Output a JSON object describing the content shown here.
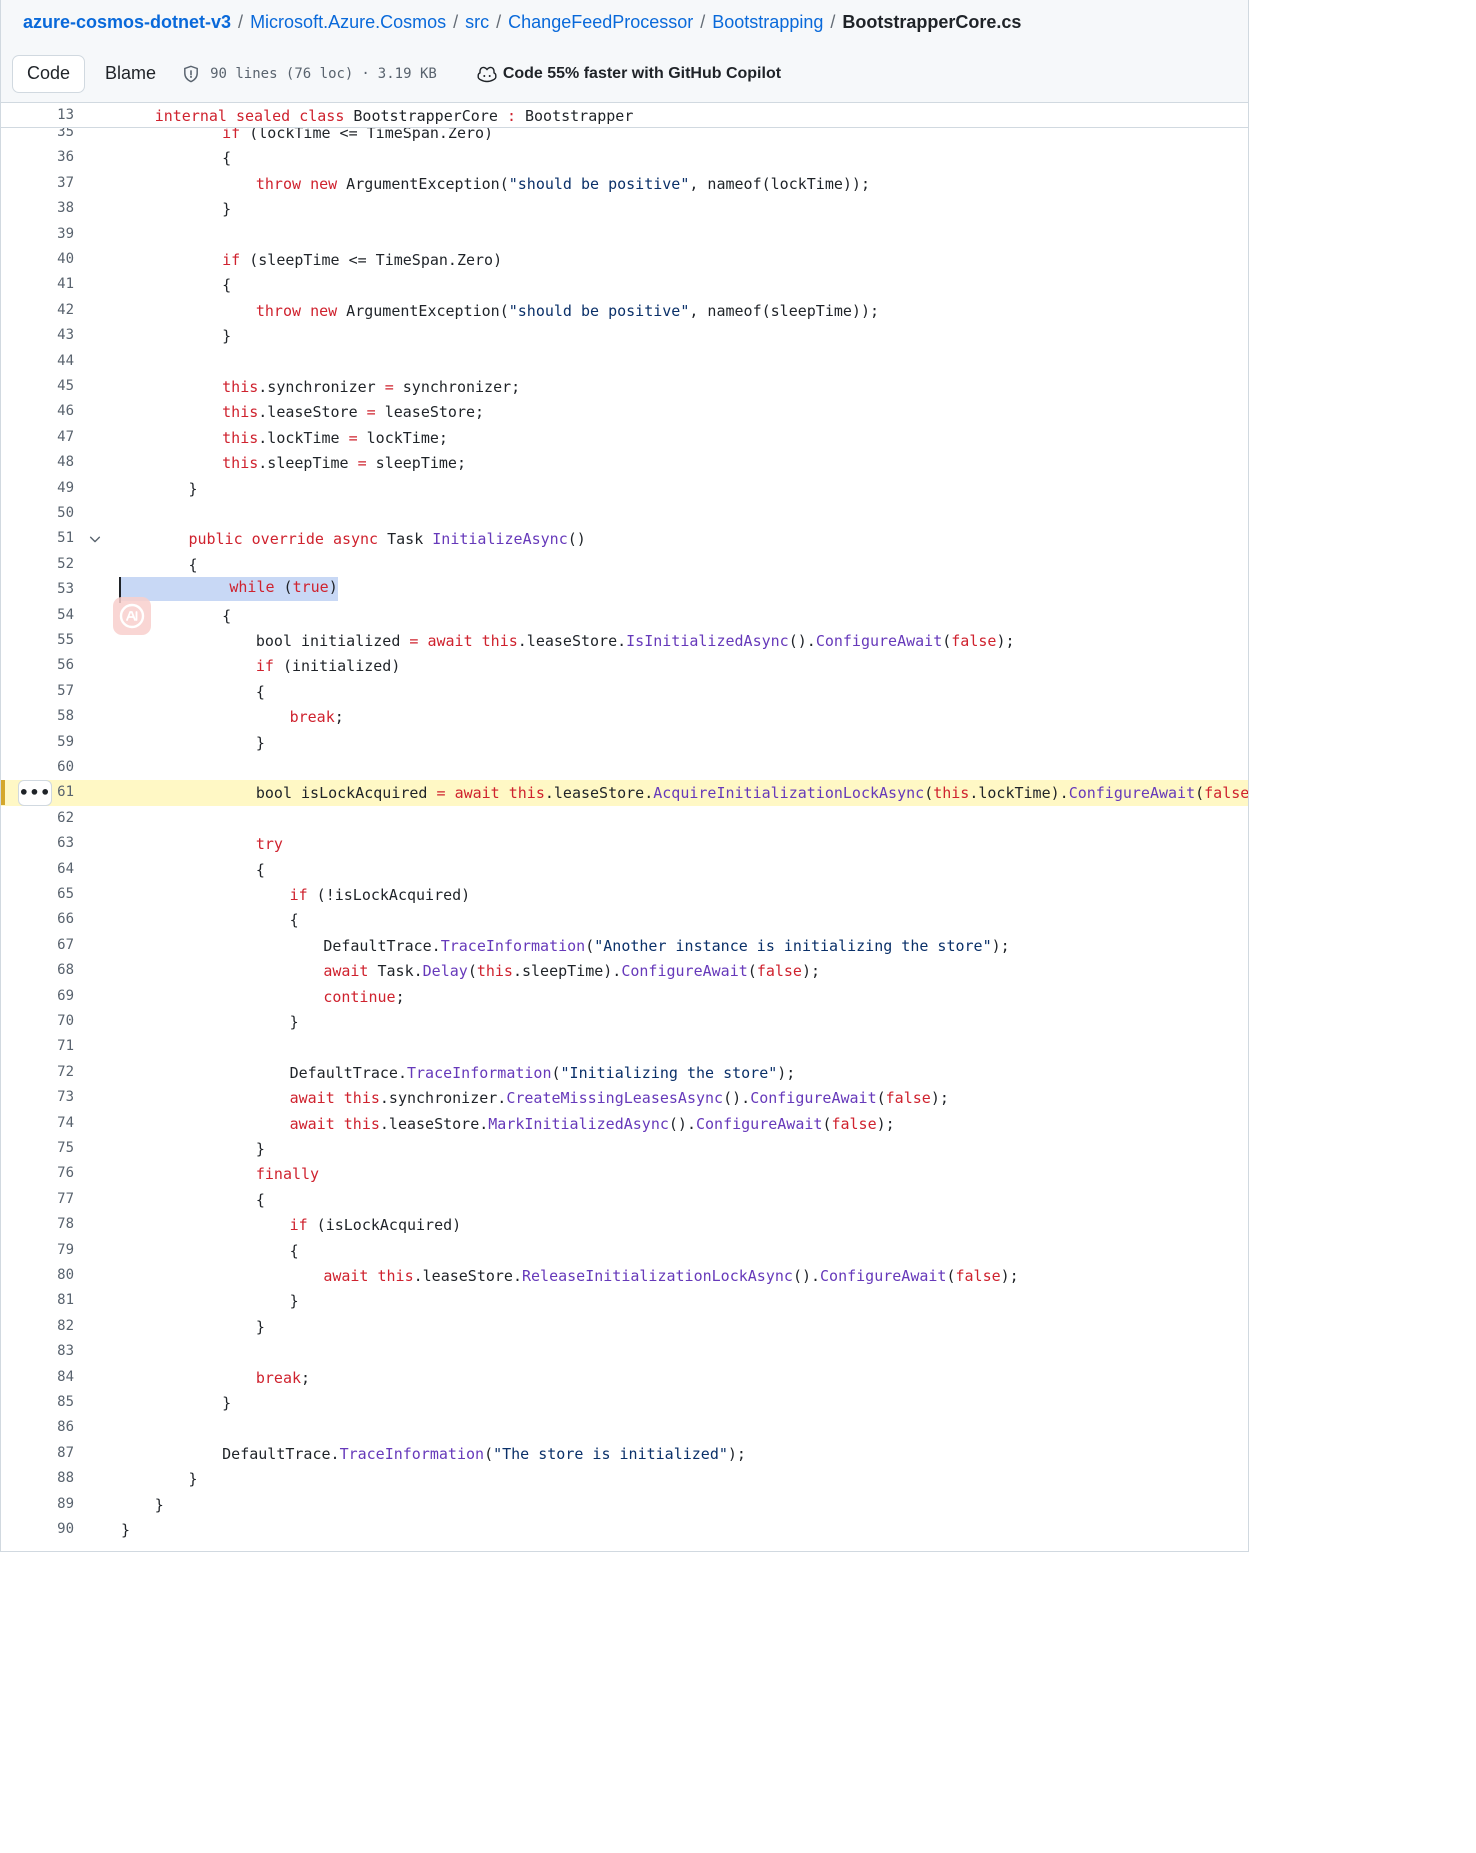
{
  "breadcrumb": {
    "repo": "azure-cosmos-dotnet-v3",
    "segments": [
      "Microsoft.Azure.Cosmos",
      "src",
      "ChangeFeedProcessor",
      "Bootstrapping"
    ],
    "current": "BootstrapperCore.cs",
    "separator": "/"
  },
  "toolbar": {
    "code_tab": "Code",
    "blame_tab": "Blame",
    "lines_info": "90 lines (76 loc)",
    "size_info": "3.19 KB",
    "dot": "·",
    "copilot_text": "Code 55% faster with GitHub Copilot"
  },
  "sticky": {
    "line_number": "13",
    "code": [
      {
        "t": "internal",
        "c": "k"
      },
      {
        "t": " "
      },
      {
        "t": "sealed",
        "c": "k"
      },
      {
        "t": " "
      },
      {
        "t": "class",
        "c": "k"
      },
      {
        "t": " BootstrapperCore "
      },
      {
        "t": ":",
        "c": "k"
      },
      {
        "t": " Bootstrapper"
      }
    ],
    "indent": 4
  },
  "code_lines": [
    {
      "n": "35",
      "i": 12,
      "partial": true,
      "tokens": [
        {
          "t": "if",
          "c": "k"
        },
        {
          "t": " (lockTime <= TimeSpan.Zero)"
        }
      ]
    },
    {
      "n": "36",
      "i": 12,
      "tokens": [
        {
          "t": "{"
        }
      ]
    },
    {
      "n": "37",
      "i": 16,
      "tokens": [
        {
          "t": "throw",
          "c": "k"
        },
        {
          "t": " "
        },
        {
          "t": "new",
          "c": "k"
        },
        {
          "t": " ArgumentException("
        },
        {
          "t": "\"should be positive\"",
          "c": "s"
        },
        {
          "t": ", nameof(lockTime));"
        }
      ]
    },
    {
      "n": "38",
      "i": 12,
      "tokens": [
        {
          "t": "}"
        }
      ]
    },
    {
      "n": "39",
      "i": 0,
      "tokens": []
    },
    {
      "n": "40",
      "i": 12,
      "tokens": [
        {
          "t": "if",
          "c": "k"
        },
        {
          "t": " (sleepTime <= TimeSpan.Zero)"
        }
      ]
    },
    {
      "n": "41",
      "i": 12,
      "tokens": [
        {
          "t": "{"
        }
      ]
    },
    {
      "n": "42",
      "i": 16,
      "tokens": [
        {
          "t": "throw",
          "c": "k"
        },
        {
          "t": " "
        },
        {
          "t": "new",
          "c": "k"
        },
        {
          "t": " ArgumentException("
        },
        {
          "t": "\"should be positive\"",
          "c": "s"
        },
        {
          "t": ", nameof(sleepTime));"
        }
      ]
    },
    {
      "n": "43",
      "i": 12,
      "tokens": [
        {
          "t": "}"
        }
      ]
    },
    {
      "n": "44",
      "i": 0,
      "tokens": []
    },
    {
      "n": "45",
      "i": 12,
      "tokens": [
        {
          "t": "this",
          "c": "k"
        },
        {
          "t": ".synchronizer "
        },
        {
          "t": "=",
          "c": "k"
        },
        {
          "t": " synchronizer;"
        }
      ]
    },
    {
      "n": "46",
      "i": 12,
      "tokens": [
        {
          "t": "this",
          "c": "k"
        },
        {
          "t": ".leaseStore "
        },
        {
          "t": "=",
          "c": "k"
        },
        {
          "t": " leaseStore;"
        }
      ]
    },
    {
      "n": "47",
      "i": 12,
      "tokens": [
        {
          "t": "this",
          "c": "k"
        },
        {
          "t": ".lockTime "
        },
        {
          "t": "=",
          "c": "k"
        },
        {
          "t": " lockTime;"
        }
      ]
    },
    {
      "n": "48",
      "i": 12,
      "tokens": [
        {
          "t": "this",
          "c": "k"
        },
        {
          "t": ".sleepTime "
        },
        {
          "t": "=",
          "c": "k"
        },
        {
          "t": " sleepTime;"
        }
      ]
    },
    {
      "n": "49",
      "i": 8,
      "tokens": [
        {
          "t": "}"
        }
      ]
    },
    {
      "n": "50",
      "i": 0,
      "tokens": []
    },
    {
      "n": "51",
      "i": 8,
      "fold": true,
      "tokens": [
        {
          "t": "public",
          "c": "k"
        },
        {
          "t": " "
        },
        {
          "t": "override",
          "c": "k"
        },
        {
          "t": " "
        },
        {
          "t": "async",
          "c": "k"
        },
        {
          "t": " Task "
        },
        {
          "t": "InitializeAsync",
          "c": "f"
        },
        {
          "t": "()"
        }
      ]
    },
    {
      "n": "52",
      "i": 8,
      "tokens": [
        {
          "t": "{"
        }
      ]
    },
    {
      "n": "53",
      "i": 0,
      "selected": true,
      "tokens": [
        {
          "t": "            ",
          "sel": true
        },
        {
          "t": "while",
          "c": "k",
          "sel": true
        },
        {
          "t": " (",
          "sel": true
        },
        {
          "t": "true",
          "c": "k",
          "sel": true
        },
        {
          "t": ")",
          "sel": true
        }
      ]
    },
    {
      "n": "54",
      "i": 12,
      "tokens": [
        {
          "t": "{"
        }
      ]
    },
    {
      "n": "55",
      "i": 16,
      "tokens": [
        {
          "t": "bool initialized "
        },
        {
          "t": "=",
          "c": "k"
        },
        {
          "t": " "
        },
        {
          "t": "await",
          "c": "k"
        },
        {
          "t": " "
        },
        {
          "t": "this",
          "c": "k"
        },
        {
          "t": ".leaseStore."
        },
        {
          "t": "IsInitializedAsync",
          "c": "f"
        },
        {
          "t": "()."
        },
        {
          "t": "ConfigureAwait",
          "c": "f"
        },
        {
          "t": "("
        },
        {
          "t": "false",
          "c": "k"
        },
        {
          "t": ");"
        }
      ]
    },
    {
      "n": "56",
      "i": 16,
      "tokens": [
        {
          "t": "if",
          "c": "k"
        },
        {
          "t": " (initialized)"
        }
      ]
    },
    {
      "n": "57",
      "i": 16,
      "tokens": [
        {
          "t": "{"
        }
      ]
    },
    {
      "n": "58",
      "i": 20,
      "tokens": [
        {
          "t": "break",
          "c": "k"
        },
        {
          "t": ";"
        }
      ]
    },
    {
      "n": "59",
      "i": 16,
      "tokens": [
        {
          "t": "}"
        }
      ]
    },
    {
      "n": "60",
      "i": 0,
      "tokens": []
    },
    {
      "n": "61",
      "i": 16,
      "highlight": true,
      "tokens": [
        {
          "t": "bool isLockAcquired "
        },
        {
          "t": "=",
          "c": "k"
        },
        {
          "t": " "
        },
        {
          "t": "await",
          "c": "k"
        },
        {
          "t": " "
        },
        {
          "t": "this",
          "c": "k"
        },
        {
          "t": ".leaseStore."
        },
        {
          "t": "AcquireInitializationLockAsync",
          "c": "f"
        },
        {
          "t": "("
        },
        {
          "t": "this",
          "c": "k"
        },
        {
          "t": ".lockTime)."
        },
        {
          "t": "ConfigureAwait",
          "c": "f"
        },
        {
          "t": "("
        },
        {
          "t": "false",
          "c": "k"
        },
        {
          "t": ");"
        }
      ]
    },
    {
      "n": "62",
      "i": 0,
      "tokens": []
    },
    {
      "n": "63",
      "i": 16,
      "tokens": [
        {
          "t": "try",
          "c": "k"
        }
      ]
    },
    {
      "n": "64",
      "i": 16,
      "tokens": [
        {
          "t": "{"
        }
      ]
    },
    {
      "n": "65",
      "i": 20,
      "tokens": [
        {
          "t": "if",
          "c": "k"
        },
        {
          "t": " (!isLockAcquired)"
        }
      ]
    },
    {
      "n": "66",
      "i": 20,
      "tokens": [
        {
          "t": "{"
        }
      ]
    },
    {
      "n": "67",
      "i": 24,
      "tokens": [
        {
          "t": "DefaultTrace."
        },
        {
          "t": "TraceInformation",
          "c": "f"
        },
        {
          "t": "("
        },
        {
          "t": "\"Another instance is initializing the store\"",
          "c": "s"
        },
        {
          "t": ");"
        }
      ]
    },
    {
      "n": "68",
      "i": 24,
      "tokens": [
        {
          "t": "await",
          "c": "k"
        },
        {
          "t": " Task."
        },
        {
          "t": "Delay",
          "c": "f"
        },
        {
          "t": "("
        },
        {
          "t": "this",
          "c": "k"
        },
        {
          "t": ".sleepTime)."
        },
        {
          "t": "ConfigureAwait",
          "c": "f"
        },
        {
          "t": "("
        },
        {
          "t": "false",
          "c": "k"
        },
        {
          "t": ");"
        }
      ]
    },
    {
      "n": "69",
      "i": 24,
      "tokens": [
        {
          "t": "continue",
          "c": "k"
        },
        {
          "t": ";"
        }
      ]
    },
    {
      "n": "70",
      "i": 20,
      "tokens": [
        {
          "t": "}"
        }
      ]
    },
    {
      "n": "71",
      "i": 0,
      "tokens": []
    },
    {
      "n": "72",
      "i": 20,
      "tokens": [
        {
          "t": "DefaultTrace."
        },
        {
          "t": "TraceInformation",
          "c": "f"
        },
        {
          "t": "("
        },
        {
          "t": "\"Initializing the store\"",
          "c": "s"
        },
        {
          "t": ");"
        }
      ]
    },
    {
      "n": "73",
      "i": 20,
      "tokens": [
        {
          "t": "await",
          "c": "k"
        },
        {
          "t": " "
        },
        {
          "t": "this",
          "c": "k"
        },
        {
          "t": ".synchronizer."
        },
        {
          "t": "CreateMissingLeasesAsync",
          "c": "f"
        },
        {
          "t": "()."
        },
        {
          "t": "ConfigureAwait",
          "c": "f"
        },
        {
          "t": "("
        },
        {
          "t": "false",
          "c": "k"
        },
        {
          "t": ");"
        }
      ]
    },
    {
      "n": "74",
      "i": 20,
      "tokens": [
        {
          "t": "await",
          "c": "k"
        },
        {
          "t": " "
        },
        {
          "t": "this",
          "c": "k"
        },
        {
          "t": ".leaseStore."
        },
        {
          "t": "MarkInitializedAsync",
          "c": "f"
        },
        {
          "t": "()."
        },
        {
          "t": "ConfigureAwait",
          "c": "f"
        },
        {
          "t": "("
        },
        {
          "t": "false",
          "c": "k"
        },
        {
          "t": ");"
        }
      ]
    },
    {
      "n": "75",
      "i": 16,
      "tokens": [
        {
          "t": "}"
        }
      ]
    },
    {
      "n": "76",
      "i": 16,
      "tokens": [
        {
          "t": "finally",
          "c": "k"
        }
      ]
    },
    {
      "n": "77",
      "i": 16,
      "tokens": [
        {
          "t": "{"
        }
      ]
    },
    {
      "n": "78",
      "i": 20,
      "tokens": [
        {
          "t": "if",
          "c": "k"
        },
        {
          "t": " (isLockAcquired)"
        }
      ]
    },
    {
      "n": "79",
      "i": 20,
      "tokens": [
        {
          "t": "{"
        }
      ]
    },
    {
      "n": "80",
      "i": 24,
      "tokens": [
        {
          "t": "await",
          "c": "k"
        },
        {
          "t": " "
        },
        {
          "t": "this",
          "c": "k"
        },
        {
          "t": ".leaseStore."
        },
        {
          "t": "ReleaseInitializationLockAsync",
          "c": "f"
        },
        {
          "t": "()."
        },
        {
          "t": "ConfigureAwait",
          "c": "f"
        },
        {
          "t": "("
        },
        {
          "t": "false",
          "c": "k"
        },
        {
          "t": ");"
        }
      ]
    },
    {
      "n": "81",
      "i": 20,
      "tokens": [
        {
          "t": "}"
        }
      ]
    },
    {
      "n": "82",
      "i": 16,
      "tokens": [
        {
          "t": "}"
        }
      ]
    },
    {
      "n": "83",
      "i": 0,
      "tokens": []
    },
    {
      "n": "84",
      "i": 16,
      "tokens": [
        {
          "t": "break",
          "c": "k"
        },
        {
          "t": ";"
        }
      ]
    },
    {
      "n": "85",
      "i": 12,
      "tokens": [
        {
          "t": "}"
        }
      ]
    },
    {
      "n": "86",
      "i": 0,
      "tokens": []
    },
    {
      "n": "87",
      "i": 12,
      "tokens": [
        {
          "t": "DefaultTrace."
        },
        {
          "t": "TraceInformation",
          "c": "f"
        },
        {
          "t": "("
        },
        {
          "t": "\"The store is initialized\"",
          "c": "s"
        },
        {
          "t": ");"
        }
      ]
    },
    {
      "n": "88",
      "i": 8,
      "tokens": [
        {
          "t": "}"
        }
      ]
    },
    {
      "n": "89",
      "i": 4,
      "tokens": [
        {
          "t": "}"
        }
      ]
    },
    {
      "n": "90",
      "i": 0,
      "tokens": [
        {
          "t": "}"
        }
      ]
    }
  ],
  "icons": {
    "shield": "shield-icon",
    "copilot": "copilot-icon",
    "fold": "chevron-down-icon",
    "more": "kebab-horizontal-icon",
    "ai": "ai-assistant-icon"
  },
  "more_button_label": "•••",
  "colors": {
    "keyword": "#cf222e",
    "function": "#6639ba",
    "string": "#0a3069",
    "selection": "#c8d8f5",
    "line_highlight": "#fff8c5",
    "link": "#0969da"
  }
}
